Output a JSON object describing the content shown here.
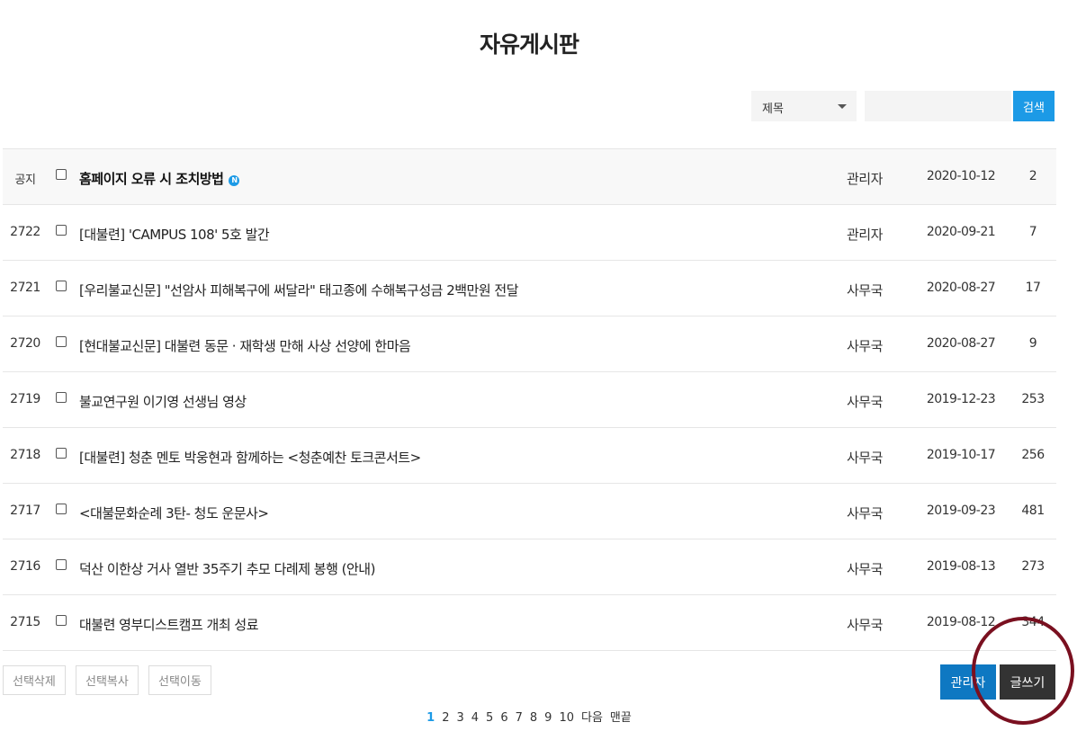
{
  "page_title": "자유게시판",
  "search": {
    "field_selected": "제목",
    "input_value": "",
    "button_label": "검색"
  },
  "posts": [
    {
      "num": "공지",
      "title": "홈페이지 오류 시 조치방법",
      "new_badge": "N",
      "author": "관리자",
      "date": "2020-10-12",
      "views": "2"
    },
    {
      "num": "2722",
      "title": "[대불련] 'CAMPUS 108' 5호 발간",
      "author": "관리자",
      "date": "2020-09-21",
      "views": "7"
    },
    {
      "num": "2721",
      "title": "[우리불교신문] \"선암사 피해복구에 써달라\" 태고종에 수해복구성금 2백만원 전달",
      "author": "사무국",
      "date": "2020-08-27",
      "views": "17"
    },
    {
      "num": "2720",
      "title": "[현대불교신문] 대불련 동문 · 재학생 만해 사상 선양에 한마음",
      "author": "사무국",
      "date": "2020-08-27",
      "views": "9"
    },
    {
      "num": "2719",
      "title": "불교연구원 이기영 선생님 영상",
      "author": "사무국",
      "date": "2019-12-23",
      "views": "253"
    },
    {
      "num": "2718",
      "title": "[대불련] 청춘 멘토 박웅현과 함께하는 <청춘예찬 토크콘서트>",
      "author": "사무국",
      "date": "2019-10-17",
      "views": "256"
    },
    {
      "num": "2717",
      "title": "<대불문화순례 3탄- 청도 운문사>",
      "author": "사무국",
      "date": "2019-09-23",
      "views": "481"
    },
    {
      "num": "2716",
      "title": "덕산 이한상 거사 열반 35주기 추모 다례제 봉행 (안내)",
      "author": "사무국",
      "date": "2019-08-13",
      "views": "273"
    },
    {
      "num": "2715",
      "title": "대불련 영부디스트캠프 개최 성료",
      "author": "사무국",
      "date": "2019-08-12",
      "views": "344"
    }
  ],
  "actions": {
    "delete_selected": "선택삭제",
    "copy_selected": "선택복사",
    "move_selected": "선택이동",
    "admin": "관리자",
    "write": "글쓰기"
  },
  "pagination": {
    "pages": [
      "1",
      "2",
      "3",
      "4",
      "5",
      "6",
      "7",
      "8",
      "9",
      "10"
    ],
    "current": "1",
    "next": "다음",
    "last": "맨끝"
  },
  "colors": {
    "accent": "#1c9ae6",
    "admin_button": "#0e78c2",
    "write_button": "#333333",
    "highlight_circle": "#7a1020"
  }
}
